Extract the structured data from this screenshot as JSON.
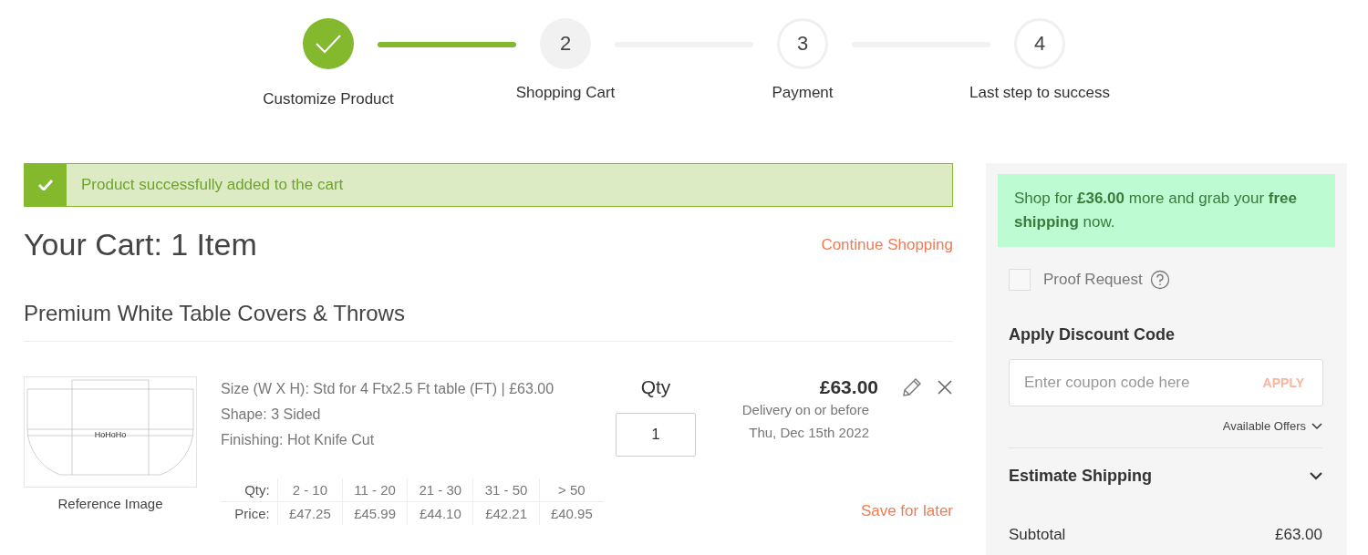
{
  "stepper": [
    {
      "label": "Customize Product",
      "completed": true,
      "selected": false
    },
    {
      "number": "2",
      "label": "Shopping Cart",
      "completed": false,
      "selected": true
    },
    {
      "number": "3",
      "label": "Payment",
      "completed": false,
      "selected": false
    },
    {
      "number": "4",
      "label": "Last step to success",
      "completed": false,
      "selected": false
    }
  ],
  "alert": {
    "message": "Product successfully added to the cart"
  },
  "cart": {
    "title": "Your Cart: 1 Item",
    "continue_link": "Continue Shopping",
    "section_title": "Premium White Table Covers & Throws",
    "item": {
      "image_text": "HoHoHo",
      "image_caption": "Reference Image",
      "specs": [
        "Size (W X H): Std for 4 Ftx2.5 Ft table (FT) | £63.00",
        "Shape: 3 Sided",
        "Finishing: Hot Knife Cut"
      ],
      "tiers": {
        "qty_label": "Qty:",
        "price_label": "Price:",
        "qty": [
          "2 - 10",
          "11 - 20",
          "21 - 30",
          "31 - 50",
          "> 50"
        ],
        "price": [
          "£47.25",
          "£45.99",
          "£44.10",
          "£42.21",
          "£40.95"
        ]
      },
      "qty_label": "Qty",
      "qty_value": "1",
      "price": "£63.00",
      "delivery": [
        "Delivery on or before",
        "Thu, Dec 15th 2022"
      ],
      "save_link": "Save for later"
    }
  },
  "summary": {
    "shipping_note": "Shop for **£36.00** more and grab your **free shipping** now.",
    "proof_request": {
      "label": "Proof Request",
      "checked": false
    },
    "discount": {
      "title": "Apply Discount Code",
      "placeholder": "Enter coupon code here",
      "button": "APPLY",
      "offers": "Available Offers"
    },
    "estimate": {
      "label": "Estimate Shipping",
      "expanded": false
    },
    "subtotal": {
      "label": "Subtotal",
      "value": "£63.00"
    }
  }
}
